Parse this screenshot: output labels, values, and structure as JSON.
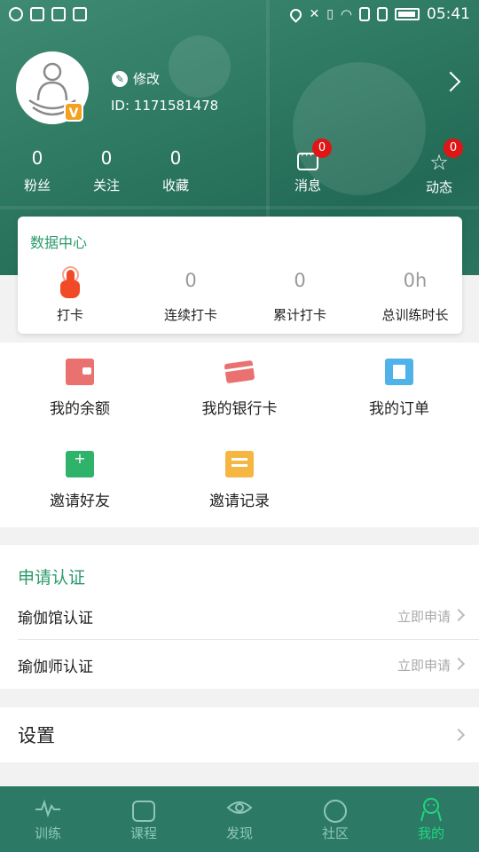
{
  "status_bar": {
    "time": "05:41"
  },
  "profile": {
    "edit_label": "修改",
    "user_id": "ID: 1171581478",
    "vip_badge": "V"
  },
  "stats": [
    {
      "value": "0",
      "label": "粉丝"
    },
    {
      "value": "0",
      "label": "关注"
    },
    {
      "value": "0",
      "label": "收藏"
    }
  ],
  "messages": {
    "label": "消息",
    "badge": "0"
  },
  "activity": {
    "label": "动态",
    "badge": "0"
  },
  "data_center": {
    "title": "数据中心",
    "checkin_label": "打卡",
    "items": [
      {
        "value": "0",
        "label": "连续打卡"
      },
      {
        "value": "0",
        "label": "累计打卡"
      },
      {
        "value": "0h",
        "label": "总训练时长"
      }
    ]
  },
  "menu": [
    {
      "label": "我的余额",
      "icon": "wallet-icon",
      "color": "#e9716f"
    },
    {
      "label": "我的银行卡",
      "icon": "bank-card-icon",
      "color": "#e9716f"
    },
    {
      "label": "我的订单",
      "icon": "order-icon",
      "color": "#4fb3e9"
    },
    {
      "label": "邀请好友",
      "icon": "invite-friend-icon",
      "color": "#2fb36b"
    },
    {
      "label": "邀请记录",
      "icon": "invite-record-icon",
      "color": "#f5b642"
    }
  ],
  "certification": {
    "title": "申请认证",
    "rows": [
      {
        "label": "瑜伽馆认证",
        "action": "立即申请"
      },
      {
        "label": "瑜伽师认证",
        "action": "立即申请"
      }
    ]
  },
  "settings": {
    "label": "设置"
  },
  "tabs": [
    {
      "label": "训练",
      "icon": "pulse-icon"
    },
    {
      "label": "课程",
      "icon": "course-icon"
    },
    {
      "label": "发现",
      "icon": "eye-icon"
    },
    {
      "label": "社区",
      "icon": "community-icon"
    },
    {
      "label": "我的",
      "icon": "me-icon",
      "active": true
    }
  ],
  "colors": {
    "brand_green": "#2c9a6d",
    "header_green": "#2f7a63",
    "tab_active": "#20d67f",
    "badge_red": "#e01515"
  }
}
